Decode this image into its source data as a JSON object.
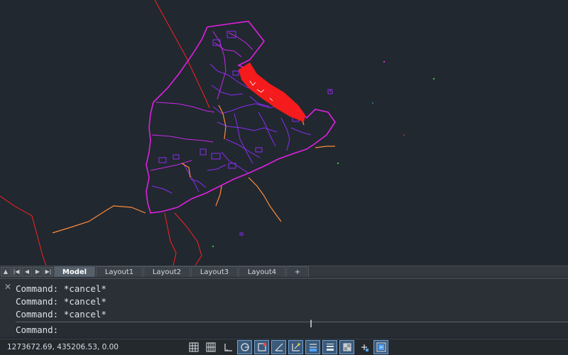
{
  "layout_tabs": {
    "nav": [
      "first",
      "previous",
      "next",
      "last"
    ],
    "tabs": [
      {
        "label": "Model",
        "active": true
      },
      {
        "label": "Layout1",
        "active": false
      },
      {
        "label": "Layout2",
        "active": false
      },
      {
        "label": "Layout3",
        "active": false
      },
      {
        "label": "Layout4",
        "active": false
      },
      {
        "label": "+",
        "active": false
      }
    ]
  },
  "command": {
    "history": [
      "Command: *cancel*",
      "Command: *cancel*",
      "Command: *cancel*"
    ],
    "prompt": "Command:",
    "input_value": ""
  },
  "status": {
    "coordinates": "1273672.69, 435206.53, 0.00",
    "toggles": [
      {
        "icon": "grid-display-icon",
        "on": false
      },
      {
        "icon": "snap-grid-icon",
        "on": false
      },
      {
        "icon": "ortho-mode-icon",
        "on": false
      },
      {
        "icon": "polar-tracking-icon",
        "on": true
      },
      {
        "icon": "object-snap-icon",
        "on": true
      },
      {
        "icon": "object-snap-tracking-icon",
        "on": true
      },
      {
        "icon": "dynamic-ucs-icon",
        "on": true
      },
      {
        "icon": "dynamic-input-icon",
        "on": true
      },
      {
        "icon": "lineweight-icon",
        "on": true
      },
      {
        "icon": "transparency-icon",
        "on": true
      },
      {
        "icon": "selection-cycling-icon",
        "on": false
      },
      {
        "icon": "annotation-monitor-icon",
        "on": true
      }
    ]
  },
  "colors": {
    "canvas_bg": "#212830",
    "boundary_magenta": "#e020e0",
    "parcel_purple": "#8a2cf0",
    "road_orange": "#ff8a3a",
    "red_lines": "#ff1a1a",
    "toggle_on": "#3b5a7a"
  }
}
